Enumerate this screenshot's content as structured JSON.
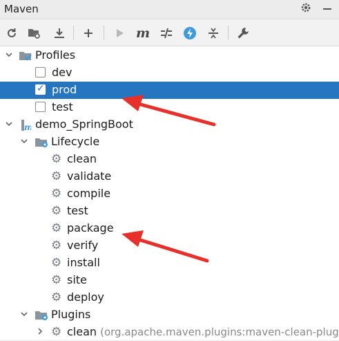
{
  "window": {
    "title": "Maven"
  },
  "titlebar_icons": [
    "gear-icon",
    "minimize-icon"
  ],
  "toolbar": {
    "buttons": [
      {
        "name": "reload-icon"
      },
      {
        "name": "add-maven-projects-icon"
      },
      {
        "name": "download-sources-icon"
      },
      {
        "name": "add-icon"
      },
      {
        "name": "run-icon"
      },
      {
        "name": "execute-maven-goal-icon",
        "glyph": "m"
      },
      {
        "name": "toggle-offline-mode-icon"
      },
      {
        "name": "skip-tests-icon"
      },
      {
        "name": "show-dependencies-icon"
      },
      {
        "name": "settings-wrench-icon"
      }
    ]
  },
  "tree": {
    "profiles": {
      "label": "Profiles",
      "items": [
        {
          "label": "dev",
          "checked": false
        },
        {
          "label": "prod",
          "checked": true,
          "selected": true
        },
        {
          "label": "test",
          "checked": false
        }
      ]
    },
    "project": {
      "label": "demo_SpringBoot",
      "lifecycle": {
        "label": "Lifecycle",
        "goals": [
          "clean",
          "validate",
          "compile",
          "test",
          "package",
          "verify",
          "install",
          "site",
          "deploy"
        ]
      },
      "plugins": {
        "label": "Plugins",
        "items": [
          {
            "label": "clean",
            "hint": "(org.apache.maven.plugins:maven-clean-plugi"
          }
        ]
      }
    }
  },
  "colors": {
    "selection": "#2675bf",
    "annotation_arrow": "#e8302a",
    "folder_blue": "#4a9fd8"
  }
}
